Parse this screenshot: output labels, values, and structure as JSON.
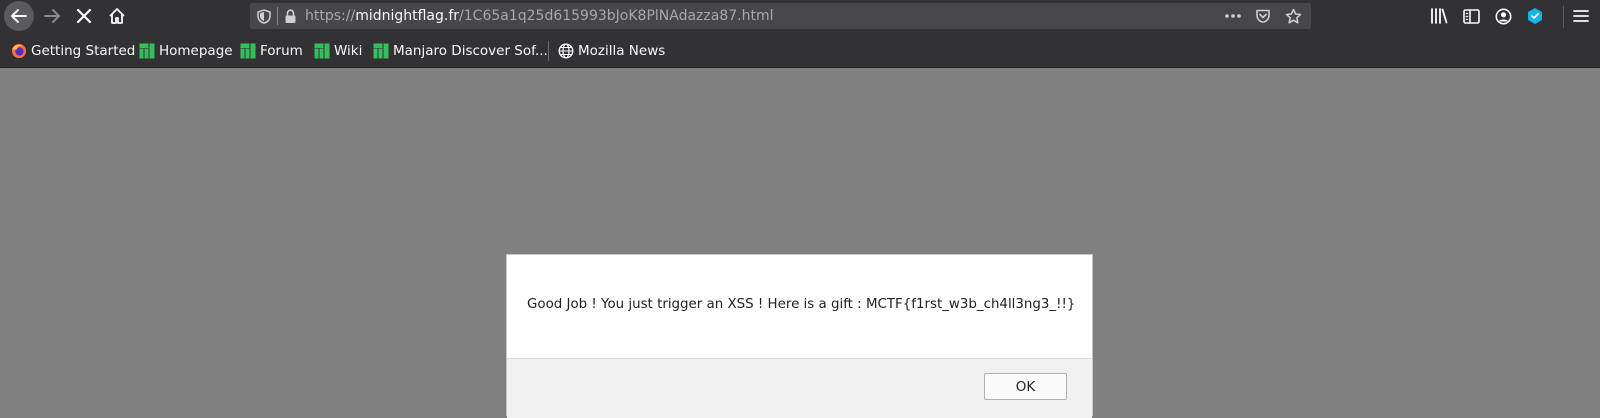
{
  "toolbar": {
    "icons": [
      "back-arrow-icon",
      "forward-arrow-icon",
      "stop-loading-icon",
      "home-icon"
    ]
  },
  "urlbar": {
    "scheme": "https://",
    "host": "midnightflag.fr",
    "path": "/1C65a1q25d615993bJoK8PlNAdazza87.html",
    "icons": [
      "tracking-shield-icon",
      "lock-icon",
      "page-actions-icon",
      "pocket-icon",
      "bookmark-star-icon"
    ]
  },
  "right_tools": {
    "icons": [
      "library-icon",
      "sidebar-icon",
      "account-icon",
      "extension-icon",
      "hamburger-menu-icon"
    ]
  },
  "bookmarks": [
    {
      "label": "Getting Started",
      "icon": "firefox-icon"
    },
    {
      "label": "Homepage",
      "icon": "manjaro-icon"
    },
    {
      "label": "Forum",
      "icon": "manjaro-icon"
    },
    {
      "label": "Wiki",
      "icon": "manjaro-icon"
    },
    {
      "label": "Manjaro Discover Sof...",
      "icon": "manjaro-icon"
    },
    {
      "label": "Mozilla News",
      "icon": "globe-icon"
    }
  ],
  "dialog": {
    "message": "Good Job ! You just trigger an XSS ! Here is a gift : MCTF{f1rst_w3b_ch4ll3ng3_!!}",
    "ok_label": "OK"
  },
  "colors": {
    "chrome_bg": "#323234",
    "urlbar_bg": "#474749",
    "overlay_bg": "#808080",
    "manjaro_green": "#35bf5c",
    "extension_blue": "#16b4ea"
  }
}
